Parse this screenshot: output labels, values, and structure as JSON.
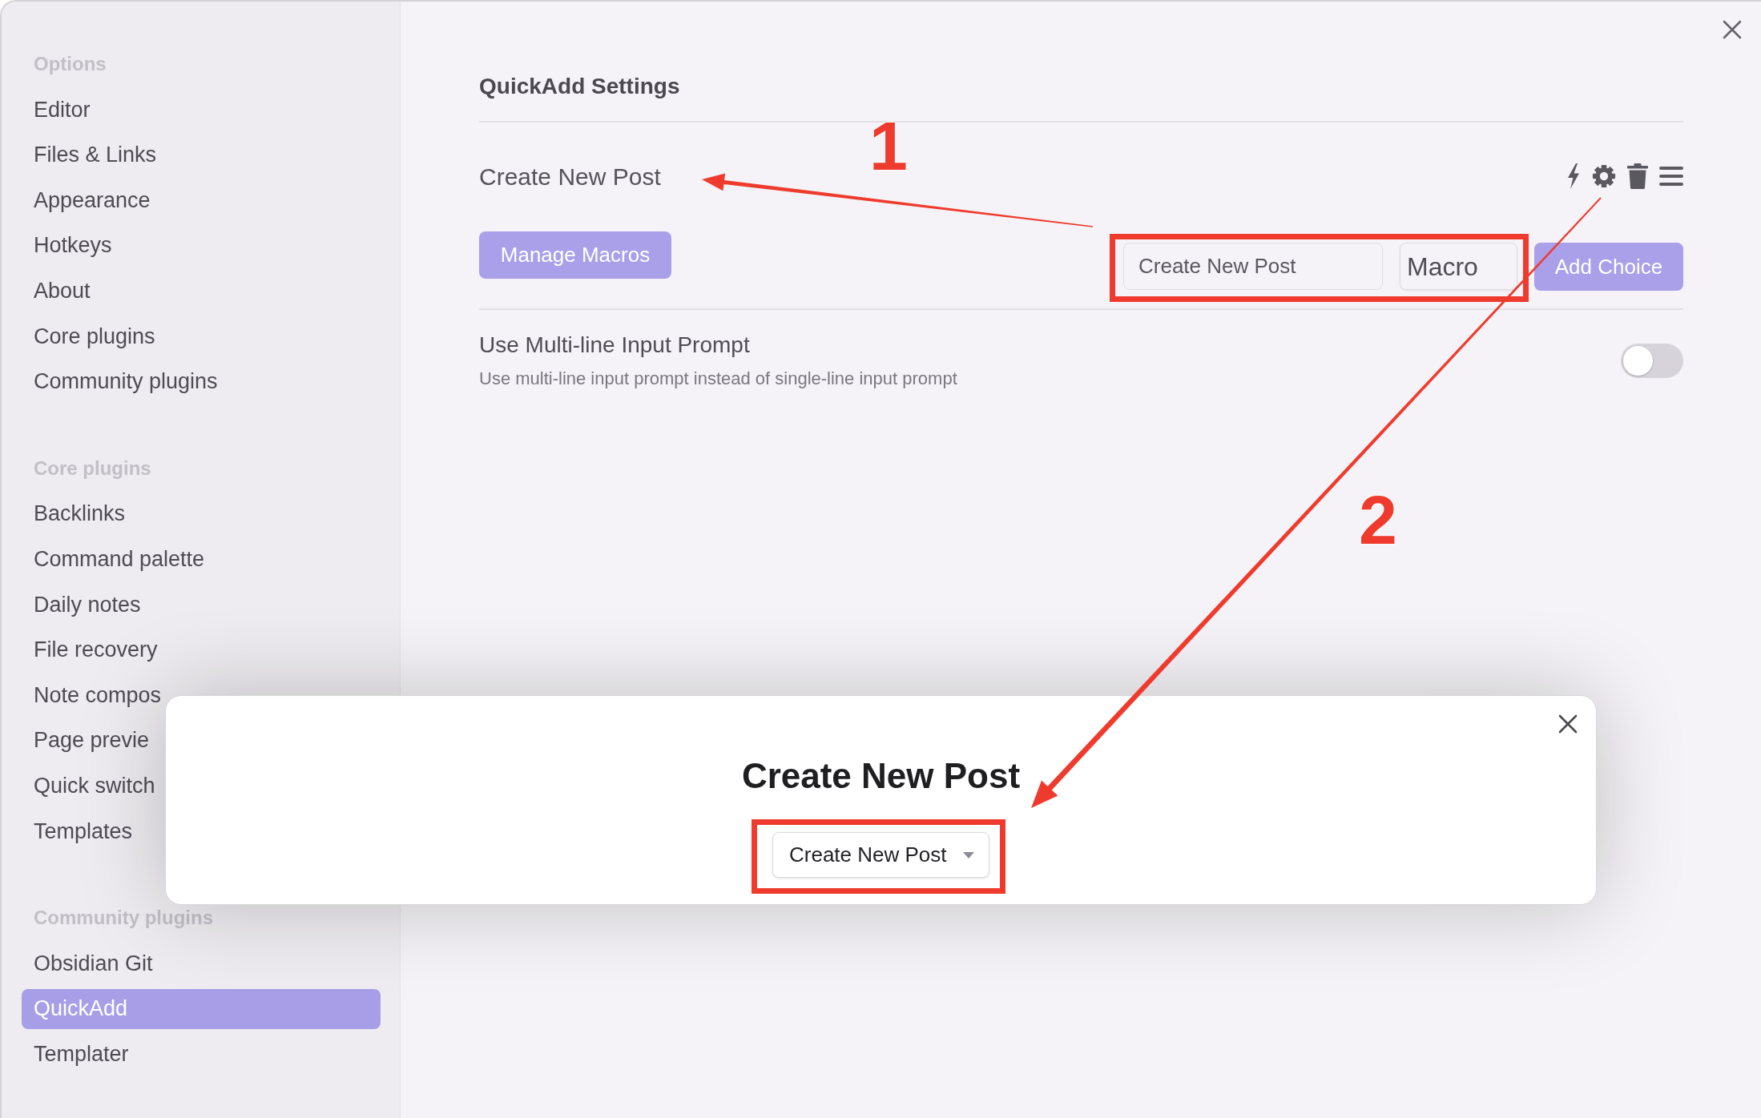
{
  "window": {
    "sidebar": {
      "sections": [
        {
          "heading": "Options",
          "items": [
            {
              "label": "Editor",
              "selected": false
            },
            {
              "label": "Files & Links",
              "selected": false
            },
            {
              "label": "Appearance",
              "selected": false
            },
            {
              "label": "Hotkeys",
              "selected": false
            },
            {
              "label": "About",
              "selected": false
            },
            {
              "label": "Core plugins",
              "selected": false
            },
            {
              "label": "Community plugins",
              "selected": false
            }
          ]
        },
        {
          "heading": "Core plugins",
          "items": [
            {
              "label": "Backlinks",
              "selected": false
            },
            {
              "label": "Command palette",
              "selected": false
            },
            {
              "label": "Daily notes",
              "selected": false
            },
            {
              "label": "File recovery",
              "selected": false
            },
            {
              "label": "Note compos",
              "selected": false
            },
            {
              "label": "Page previe",
              "selected": false
            },
            {
              "label": "Quick switch",
              "selected": false
            },
            {
              "label": "Templates",
              "selected": false
            }
          ]
        },
        {
          "heading": "Community plugins",
          "items": [
            {
              "label": "Obsidian Git",
              "selected": false
            },
            {
              "label": "QuickAdd",
              "selected": true
            },
            {
              "label": "Templater",
              "selected": false
            }
          ]
        }
      ]
    },
    "content": {
      "title": "QuickAdd Settings",
      "choices": [
        {
          "name": "Create New Post"
        }
      ],
      "manage_macros_button": "Manage Macros",
      "new_choice": {
        "name_field": {
          "value": "Create New Post"
        },
        "type_select": {
          "value": "Macro"
        },
        "add_button": "Add Choice"
      },
      "settings": [
        {
          "kind": "toggle",
          "name": "Use Multi-line Input Prompt",
          "description": "Use multi-line input prompt instead of single-line input prompt",
          "on": false
        }
      ]
    }
  },
  "modal": {
    "title": "Create New Post",
    "dropdown": {
      "value": "Create New Post"
    }
  },
  "annotations": {
    "numbers": [
      "1",
      "2"
    ]
  }
}
